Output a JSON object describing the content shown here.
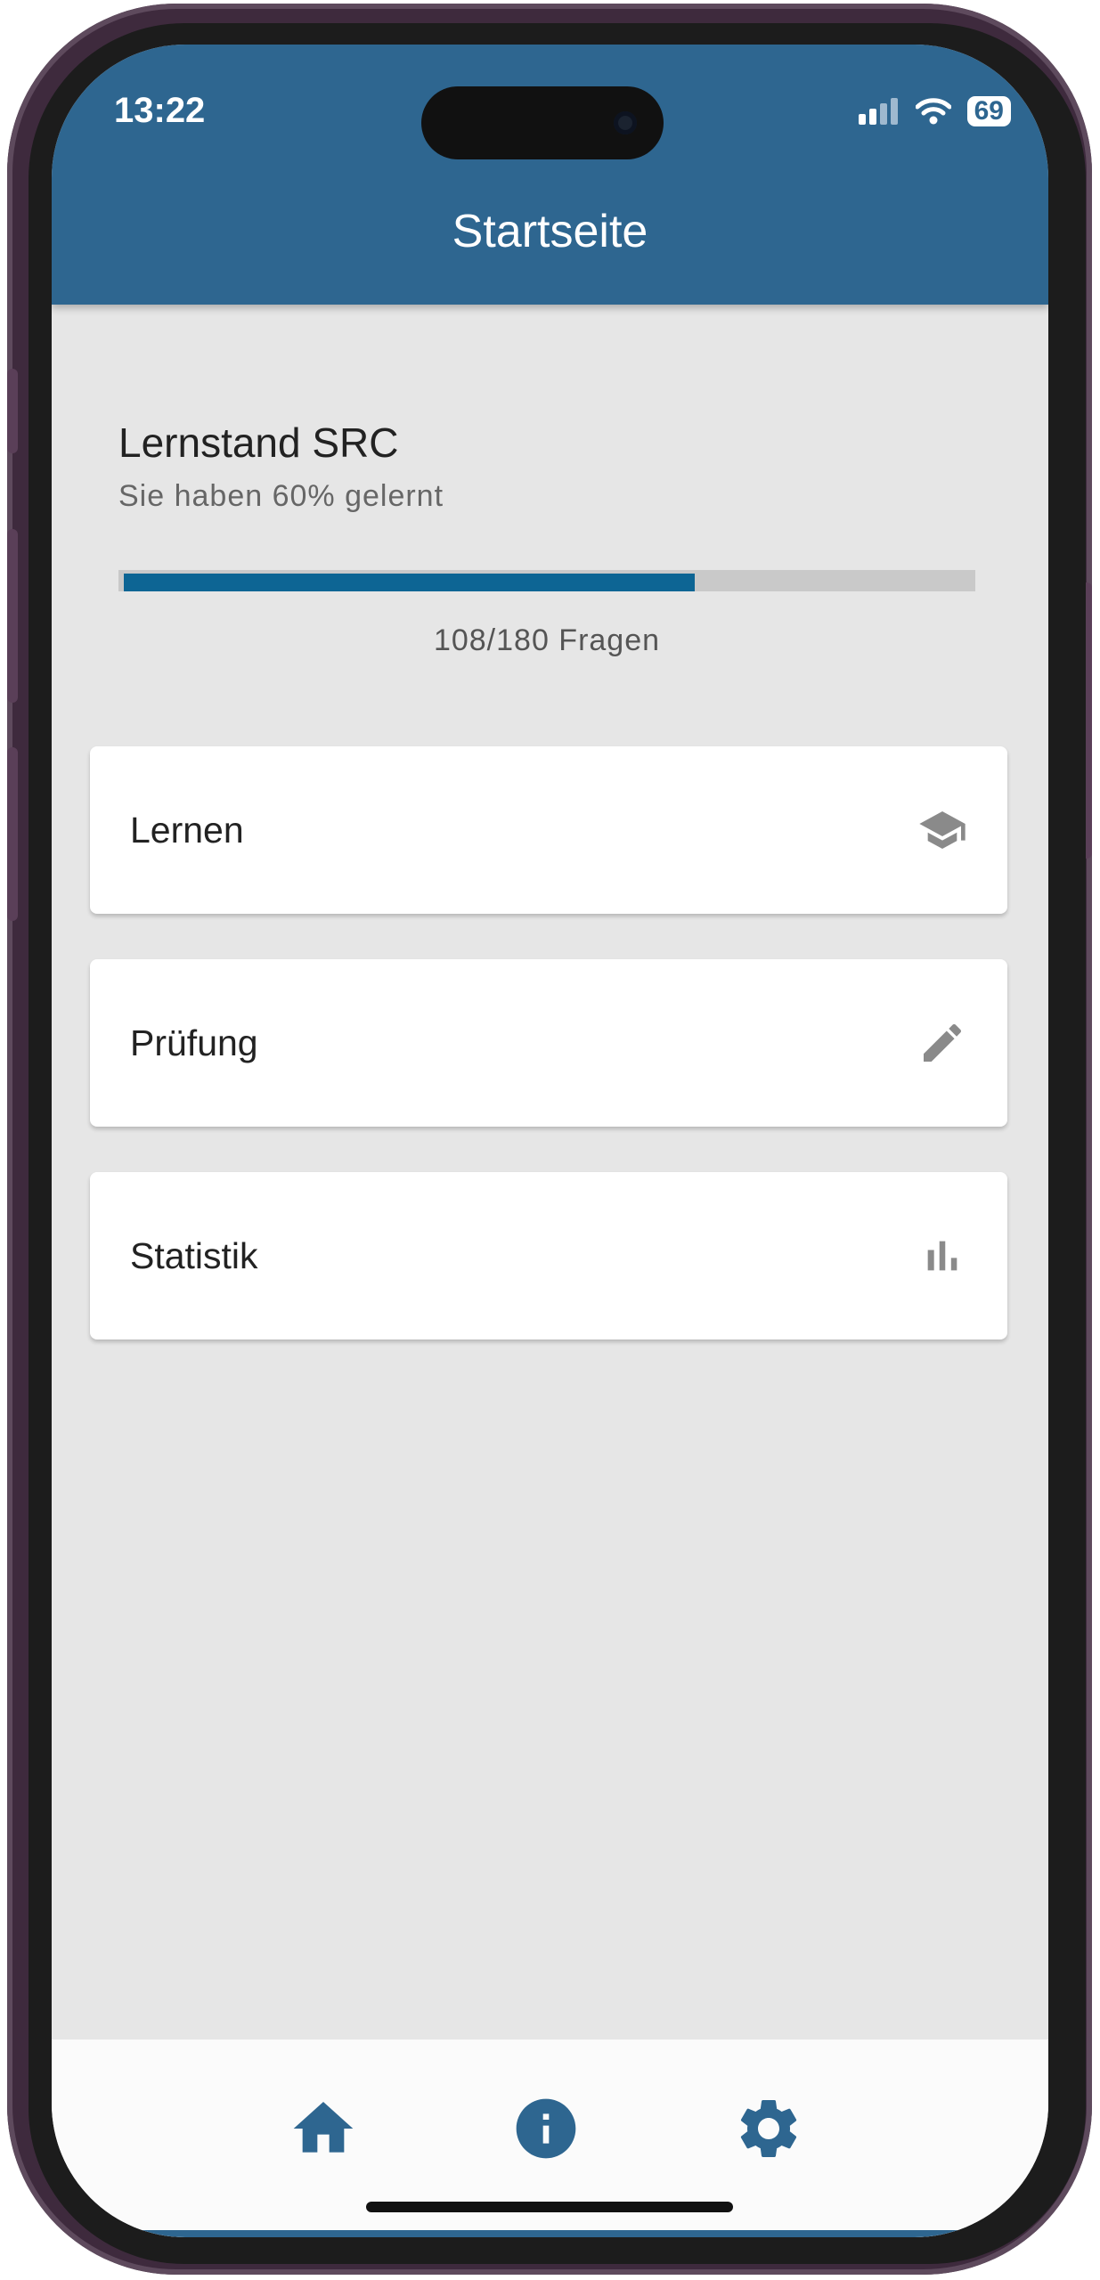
{
  "status_bar": {
    "time": "13:22",
    "battery": "69"
  },
  "app_bar": {
    "title": "Startseite"
  },
  "progress": {
    "title": "Lernstand SRC",
    "subtitle": "Sie haben 60% gelernt",
    "learned": 108,
    "total": 180,
    "fraction_shown": 0.67,
    "count_label": "108/180 Fragen"
  },
  "menu": [
    {
      "label": "Lernen",
      "icon": "graduation-cap-icon"
    },
    {
      "label": "Prüfung",
      "icon": "pencil-icon"
    },
    {
      "label": "Statistik",
      "icon": "bar-chart-icon"
    }
  ],
  "bottom_nav": [
    "home-icon",
    "info-icon",
    "settings-gear-icon"
  ],
  "colors": {
    "primary": "#2e6690",
    "progress": "#0d6594",
    "background": "#e6e6e6",
    "icon_gray": "#8a8a8a"
  }
}
